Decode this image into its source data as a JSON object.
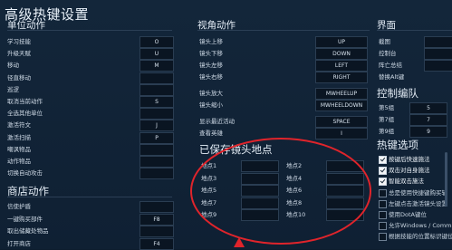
{
  "title": "高级热键设置",
  "unit_actions": {
    "heading": "单位动作",
    "items": [
      {
        "label": "学习技能",
        "key": "O"
      },
      {
        "label": "升级天赋",
        "key": "U"
      },
      {
        "label": "移动",
        "key": "M"
      },
      {
        "label": "径直移动",
        "key": ""
      },
      {
        "label": "巡逻",
        "key": ""
      },
      {
        "label": "取消当前动作",
        "key": "S"
      },
      {
        "label": "全选其他单位",
        "key": ""
      },
      {
        "label": "激活符文",
        "key": "J"
      },
      {
        "label": "激活扫描",
        "key": "P"
      },
      {
        "label": "嘲讽物品",
        "key": ""
      },
      {
        "label": "动作物品",
        "key": ""
      },
      {
        "label": "切换自动攻击",
        "key": ""
      }
    ]
  },
  "shop_actions": {
    "heading": "商店动作",
    "items": [
      {
        "label": "信使护盾",
        "key": ""
      },
      {
        "label": "一键购买部件",
        "key": "F8"
      },
      {
        "label": "取出储藏处物品",
        "key": ""
      },
      {
        "label": "打开商店",
        "key": "F4"
      }
    ]
  },
  "camera_actions": {
    "heading": "视角动作",
    "items": [
      {
        "label": "镜头上移",
        "key": "UP"
      },
      {
        "label": "镜头下移",
        "key": "DOWN"
      },
      {
        "label": "镜头左移",
        "key": "LEFT"
      },
      {
        "label": "镜头右移",
        "key": "RIGHT"
      },
      {
        "label": "镜头放大",
        "key": "MWHEELUP"
      },
      {
        "label": "镜头缩小",
        "key": "MWHEELDOWN"
      },
      {
        "label": "显示最近活动",
        "key": "SPACE"
      },
      {
        "label": "查看英雄",
        "key": "I"
      }
    ]
  },
  "saved_camera": {
    "heading": "已保存镜头地点",
    "items": [
      {
        "label": "地点1",
        "key": ""
      },
      {
        "label": "地点2",
        "key": ""
      },
      {
        "label": "地点3",
        "key": ""
      },
      {
        "label": "地点4",
        "key": ""
      },
      {
        "label": "地点5",
        "key": ""
      },
      {
        "label": "地点6",
        "key": ""
      },
      {
        "label": "地点7",
        "key": ""
      },
      {
        "label": "地点8",
        "key": ""
      },
      {
        "label": "地点9",
        "key": ""
      },
      {
        "label": "地点10",
        "key": ""
      }
    ]
  },
  "interface": {
    "heading": "界面",
    "items": [
      {
        "label": "截图"
      },
      {
        "label": "控制台"
      },
      {
        "label": "阵亡总结"
      },
      {
        "label": "替换Alt键"
      }
    ]
  },
  "control_groups": {
    "heading": "控制编队",
    "items": [
      {
        "label": "第5组",
        "key": "5"
      },
      {
        "label": "第7组",
        "key": "7"
      },
      {
        "label": "第9组",
        "key": "9"
      }
    ]
  },
  "hotkey_options": {
    "heading": "热键选项",
    "items": [
      {
        "label": "按键后快速施法",
        "checked": true
      },
      {
        "label": "双击对自身施法",
        "checked": true
      },
      {
        "label": "智能双击施法",
        "checked": true
      },
      {
        "label": "总是使用快捷键购买辅",
        "checked": false
      },
      {
        "label": "左键点击激活镜头设置",
        "checked": false
      },
      {
        "label": "使用DotA键位",
        "checked": false
      },
      {
        "label": "允许Windows / Comma",
        "checked": false
      },
      {
        "label": "根据技能的位置标识键位",
        "checked": false
      }
    ]
  },
  "colors": {
    "highlight": "#e0242b"
  }
}
